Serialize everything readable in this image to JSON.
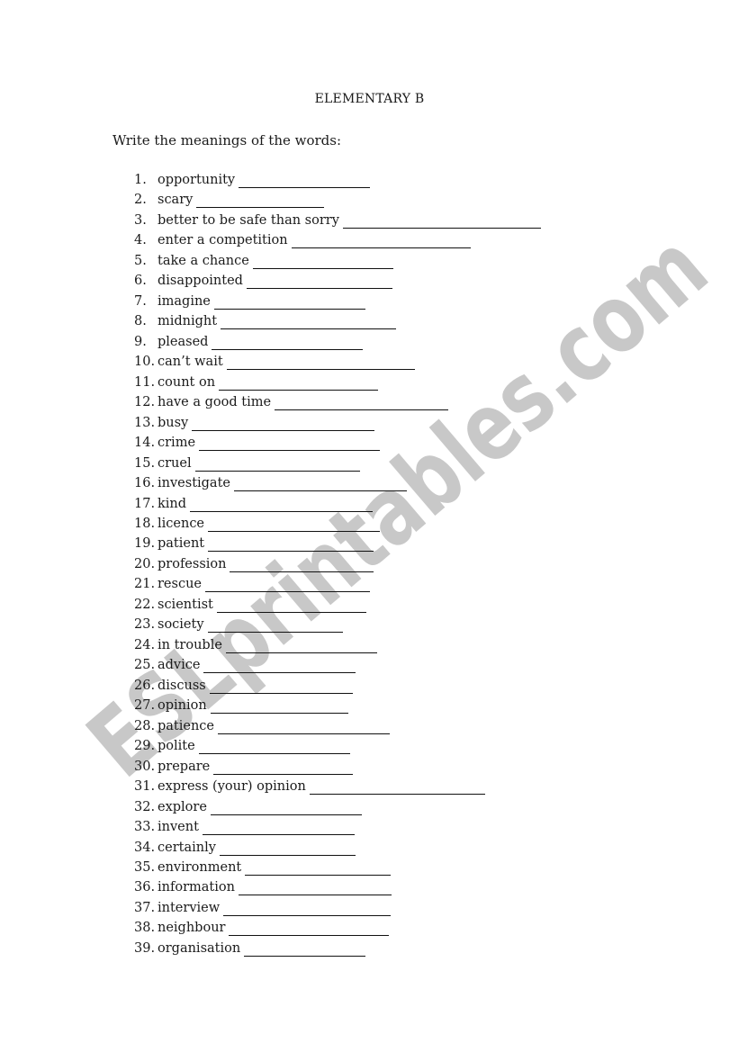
{
  "document": {
    "title": "ELEMENTARY B",
    "instruction": "Write the meanings of the words:",
    "watermark": "ESLprintables.com",
    "watermark_color": "#c8c8c8",
    "items": [
      {
        "num": "1.",
        "word": "opportunity"
      },
      {
        "num": "2.",
        "word": "scary"
      },
      {
        "num": "3.",
        "word": "better to be safe than sorry"
      },
      {
        "num": "4.",
        "word": "enter a competition"
      },
      {
        "num": "5.",
        "word": "take a chance"
      },
      {
        "num": "6.",
        "word": "disappointed"
      },
      {
        "num": "7.",
        "word": "imagine"
      },
      {
        "num": "8.",
        "word": "midnight"
      },
      {
        "num": "9.",
        "word": "pleased"
      },
      {
        "num": "10.",
        "word": "can’t wait"
      },
      {
        "num": "11.",
        "word": "count on"
      },
      {
        "num": "12.",
        "word": "have a good time"
      },
      {
        "num": "13.",
        "word": "busy"
      },
      {
        "num": "14.",
        "word": "crime"
      },
      {
        "num": "15.",
        "word": "cruel"
      },
      {
        "num": "16.",
        "word": "investigate"
      },
      {
        "num": "17.",
        "word": "kind"
      },
      {
        "num": "18.",
        "word": "licence"
      },
      {
        "num": "19.",
        "word": "patient"
      },
      {
        "num": "20.",
        "word": "profession"
      },
      {
        "num": "21.",
        "word": "rescue"
      },
      {
        "num": "22.",
        "word": "scientist"
      },
      {
        "num": "23.",
        "word": "society"
      },
      {
        "num": "24.",
        "word": "in trouble"
      },
      {
        "num": "25.",
        "word": "advice"
      },
      {
        "num": "26.",
        "word": "discuss"
      },
      {
        "num": "27.",
        "word": "opinion"
      },
      {
        "num": "28.",
        "word": "patience"
      },
      {
        "num": "29.",
        "word": "polite"
      },
      {
        "num": "30.",
        "word": "prepare"
      },
      {
        "num": "31.",
        "word": "express (your) opinion"
      },
      {
        "num": "32.",
        "word": "explore"
      },
      {
        "num": "33.",
        "word": "invent"
      },
      {
        "num": "34.",
        "word": "certainly"
      },
      {
        "num": "35.",
        "word": "environment"
      },
      {
        "num": "36.",
        "word": "information"
      },
      {
        "num": "37.",
        "word": "interview"
      },
      {
        "num": "38.",
        "word": "neighbour"
      },
      {
        "num": "39.",
        "word": "organisation"
      }
    ]
  }
}
